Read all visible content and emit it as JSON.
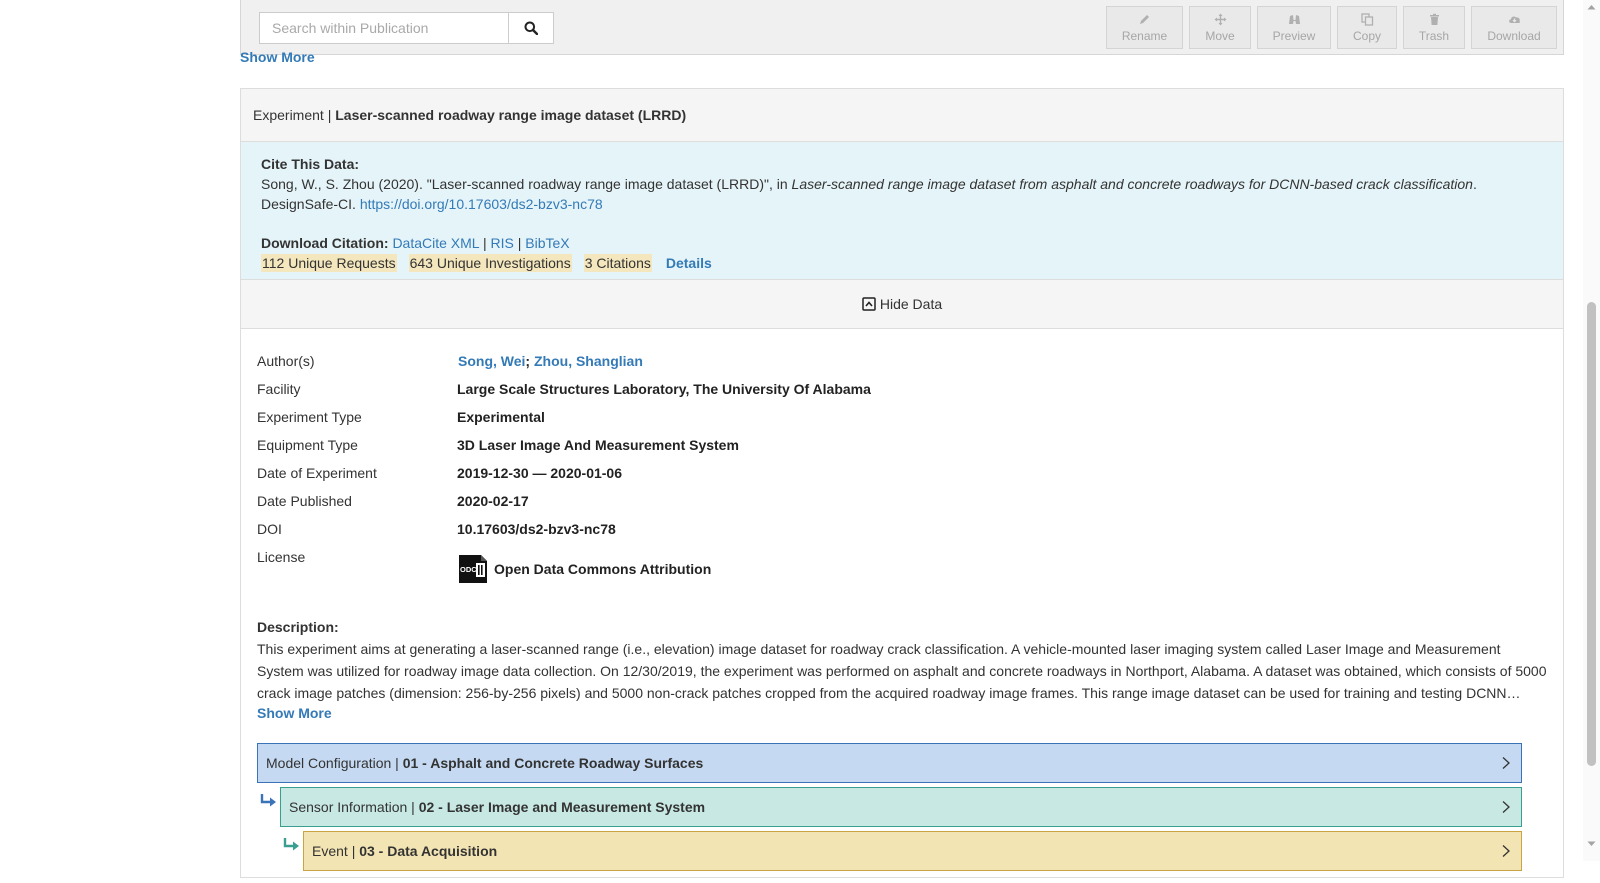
{
  "toolbar": {
    "search_placeholder": "Search within Publication",
    "buttons": {
      "rename": "Rename",
      "move": "Move",
      "preview": "Preview",
      "copy": "Copy",
      "trash": "Trash",
      "download": "Download"
    }
  },
  "top_show_more": "Show More",
  "experiment": {
    "type_label": "Experiment |",
    "title": "Laser-scanned roadway range image dataset (LRRD)",
    "cite": {
      "label": "Cite This Data:",
      "text_before": "Song, W., S. Zhou (2020). \"Laser-scanned roadway range image dataset (LRRD)\", in ",
      "text_italic": "Laser-scanned range image dataset from asphalt and concrete roadways for DCNN-based crack classification",
      "text_after": ".",
      "publisher": "DesignSafe-CI.",
      "doi_url": "https://doi.org/10.17603/ds2-bzv3-nc78",
      "download_label": "Download Citation:",
      "formats": {
        "datacite": "DataCite XML",
        "ris": "RIS",
        "bibtex": "BibTeX"
      },
      "separator": "|",
      "metrics": {
        "requests": "112 Unique Requests",
        "investigations": "643 Unique Investigations",
        "citations": "3 Citations"
      },
      "details": "Details"
    },
    "hide_data": "Hide Data",
    "meta": {
      "authors_label": "Author(s)",
      "authors": [
        "Song, Wei",
        "Zhou, Shanglian"
      ],
      "author_sep": ";",
      "facility_label": "Facility",
      "facility": "Large Scale Structures Laboratory, The University Of Alabama",
      "exp_type_label": "Experiment Type",
      "exp_type": "Experimental",
      "equip_label": "Equipment Type",
      "equip": "3D Laser Image And Measurement System",
      "date_exp_label": "Date of Experiment",
      "date_exp": "2019-12-30 — 2020-01-06",
      "date_pub_label": "Date Published",
      "date_pub": "2020-02-17",
      "doi_label": "DOI",
      "doi": "10.17603/ds2-bzv3-nc78",
      "license_label": "License",
      "license": "Open Data Commons Attribution",
      "license_badge": "ODC"
    },
    "description": {
      "label": "Description:",
      "text": "This experiment aims at generating a laser-scanned range (i.e., elevation) image dataset for roadway crack classification. A vehicle-mounted laser imaging system called Laser Image and Measurement System was utilized for roadway image data collection. On 12/30/2019, the experiment was performed on asphalt and concrete roadways in Northport, Alabama. A dataset was obtained, which consists of 5000 crack image patches (dimension: 256-by-256 pixels) and 5000 non-crack patches cropped from the acquired roadway image frames. This range image dataset can be used for training and testing DCNN…",
      "show_more": "Show More"
    },
    "tree": {
      "model": {
        "type": "Model Configuration |",
        "name": "01 - Asphalt and Concrete Roadway Surfaces"
      },
      "sensor": {
        "type": "Sensor Information |",
        "name": "02 - Laser Image and Measurement System"
      },
      "event": {
        "type": "Event |",
        "name": "03 - Data Acquisition"
      }
    }
  },
  "colors": {
    "link": "#337ab7",
    "cite_bg": "#e5f4f9",
    "metric_bg": "#f4e7bd",
    "model_bg": "#c5daf2",
    "sensor_bg": "#c8e9e3",
    "event_bg": "#f3e4b3"
  }
}
